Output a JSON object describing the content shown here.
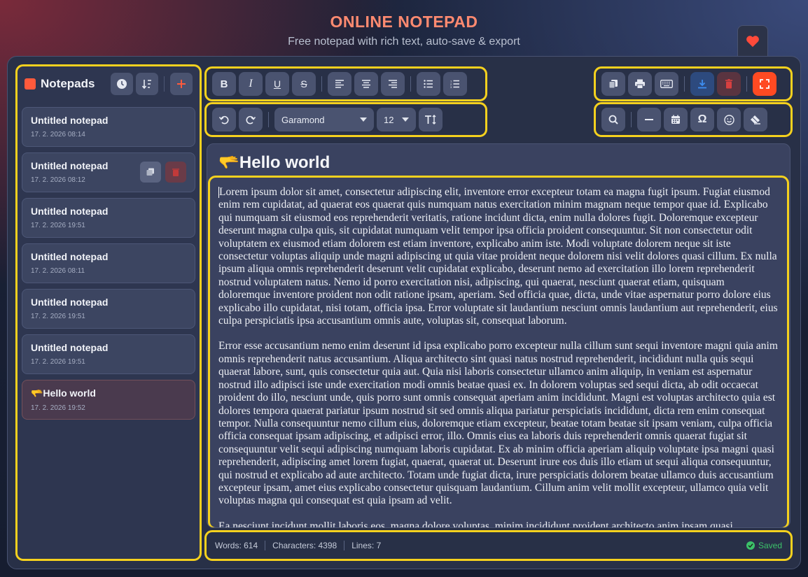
{
  "header": {
    "title": "ONLINE NOTEPAD",
    "subtitle": "Free notepad with rich text, auto-save & export"
  },
  "sidebar": {
    "title": "Notepads",
    "notes": [
      {
        "title": "Untitled notepad",
        "date": "17. 2. 2026 08:14"
      },
      {
        "title": "Untitled notepad",
        "date": "17. 2. 2026 08:12"
      },
      {
        "title": "Untitled notepad",
        "date": "17. 2. 2026 19:51"
      },
      {
        "title": "Untitled notepad",
        "date": "17. 2. 2026 08:11"
      },
      {
        "title": "Untitled notepad",
        "date": "17. 2. 2026 19:51"
      },
      {
        "title": "Untitled notepad",
        "date": "17. 2. 2026 19:51"
      },
      {
        "title": "🫳Hello world",
        "date": "17. 2. 2026 19:52"
      }
    ]
  },
  "toolbar": {
    "font": "Garamond",
    "font_size": "12"
  },
  "editor": {
    "title": "🫳Hello world",
    "paragraphs": [
      "Lorem ipsum dolor sit amet, consectetur adipiscing elit, inventore error excepteur totam ea magna fugit ipsum. Fugiat eiusmod enim rem cupidatat, ad quaerat eos quaerat quis numquam natus exercitation minim magnam neque tempor quae id. Explicabo qui numquam sit eiusmod eos reprehenderit veritatis, ratione incidunt dicta, enim nulla dolores fugit. Doloremque excepteur deserunt magna culpa quis, sit cupidatat numquam velit tempor ipsa officia proident consequuntur. Sit non consectetur odit voluptatem ex eiusmod etiam dolorem est etiam inventore, explicabo anim iste. Modi voluptate dolorem neque sit iste consectetur voluptas aliquip unde magni adipiscing ut quia vitae proident neque dolorem nisi velit dolores quasi cillum. Ex nulla ipsum aliqua omnis reprehenderit deserunt velit cupidatat explicabo, deserunt nemo ad exercitation illo lorem reprehenderit nostrud voluptatem natus. Nemo id porro exercitation nisi, adipiscing, qui quaerat, nesciunt quaerat etiam, quisquam doloremque inventore proident non odit ratione ipsam, aperiam. Sed officia quae, dicta, unde vitae aspernatur porro dolore eius explicabo illo cupidatat, nisi totam, officia ipsa. Error voluptate sit laudantium nesciunt omnis laudantium aut reprehenderit, eius culpa perspiciatis ipsa accusantium omnis aute, voluptas sit, consequat laborum.",
      "Error esse accusantium nemo enim deserunt id ipsa explicabo porro excepteur nulla cillum sunt sequi inventore magni quia anim omnis reprehenderit natus accusantium. Aliqua architecto sint quasi natus nostrud reprehenderit, incididunt nulla quis sequi quaerat labore, sunt, quis consectetur quia aut. Quia nisi laboris consectetur ullamco anim aliquip, in veniam est aspernatur nostrud illo adipisci iste unde exercitation modi omnis beatae quasi ex. In dolorem voluptas sed sequi dicta, ab odit occaecat proident do illo, nesciunt unde, quis porro sunt omnis consequat aperiam anim incididunt. Magni est voluptas architecto quia est dolores tempora quaerat pariatur ipsum nostrud sit sed omnis aliqua pariatur perspiciatis incididunt, dicta rem enim consequat tempor. Nulla consequuntur nemo cillum eius, doloremque etiam excepteur, beatae totam beatae sit ipsam veniam, culpa officia officia consequat ipsam adipiscing, et adipisci error, illo. Omnis eius ea laboris duis reprehenderit omnis quaerat fugiat sit consequuntur velit sequi adipiscing numquam laboris cupidatat. Ex ab minim officia aperiam aliquip voluptate ipsa magni quasi reprehenderit, adipiscing amet lorem fugiat, quaerat, quaerat ut. Deserunt irure eos duis illo etiam ut sequi aliqua consequuntur, qui nostrud et explicabo ad aute architecto. Totam unde fugiat dicta, irure perspiciatis dolorem beatae ullamco duis accusantium excepteur ipsam, amet eius explicabo consectetur quisquam laudantium. Cillum anim velit mollit excepteur, ullamco quia velit voluptas magna qui consequat est quia ipsam ad velit.",
      "Ea nesciunt incidunt mollit laboris eos, magna dolore voluptas, minim incididunt proident architecto anim ipsam quasi"
    ]
  },
  "status": {
    "words": "Words: 614",
    "characters": "Characters: 4398",
    "lines": "Lines: 7",
    "saved": "Saved"
  },
  "colors": {
    "accent": "#ff5a3c",
    "highlight": "#f5d11e",
    "saved": "#3cc26a"
  }
}
